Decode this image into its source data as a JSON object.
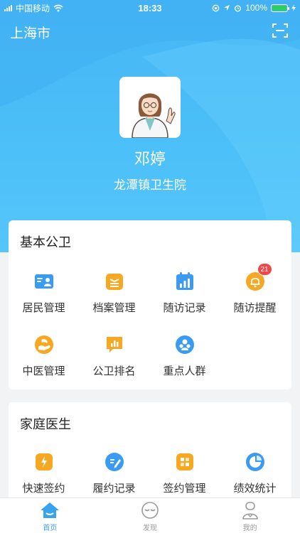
{
  "status_bar": {
    "carrier": "中国移动",
    "time": "18:33",
    "battery": "100%"
  },
  "header": {
    "city": "上海市"
  },
  "profile": {
    "name": "邓婷",
    "hospital": "龙潭镇卫生院"
  },
  "sections": [
    {
      "title": "基本公卫",
      "items": [
        {
          "label": "居民管理",
          "icon": "id-card-icon"
        },
        {
          "label": "档案管理",
          "icon": "archive-box-icon"
        },
        {
          "label": "随访记录",
          "icon": "calendar-chart-icon"
        },
        {
          "label": "随访提醒",
          "icon": "bell-icon",
          "badge": "21"
        },
        {
          "label": "中医管理",
          "icon": "tcm-hand-icon"
        },
        {
          "label": "公卫排名",
          "icon": "ranking-chat-icon"
        },
        {
          "label": "重点人群",
          "icon": "group-icon"
        }
      ]
    },
    {
      "title": "家庭医生",
      "items": [
        {
          "label": "快速签约",
          "icon": "quick-sign-icon"
        },
        {
          "label": "履约记录",
          "icon": "record-edit-icon"
        },
        {
          "label": "签约管理",
          "icon": "sign-manage-icon"
        },
        {
          "label": "绩效统计",
          "icon": "pie-chart-icon"
        }
      ]
    }
  ],
  "tabbar": [
    {
      "label": "首页",
      "icon": "home-icon",
      "active": true
    },
    {
      "label": "发现",
      "icon": "discover-icon",
      "active": false
    },
    {
      "label": "我的",
      "icon": "profile-icon",
      "active": false
    }
  ],
  "colors": {
    "accent": "#3aa3f0",
    "header": "#4cc0f8",
    "badge": "#f04848",
    "orange": "#f7a823",
    "blue": "#3b9af2"
  }
}
